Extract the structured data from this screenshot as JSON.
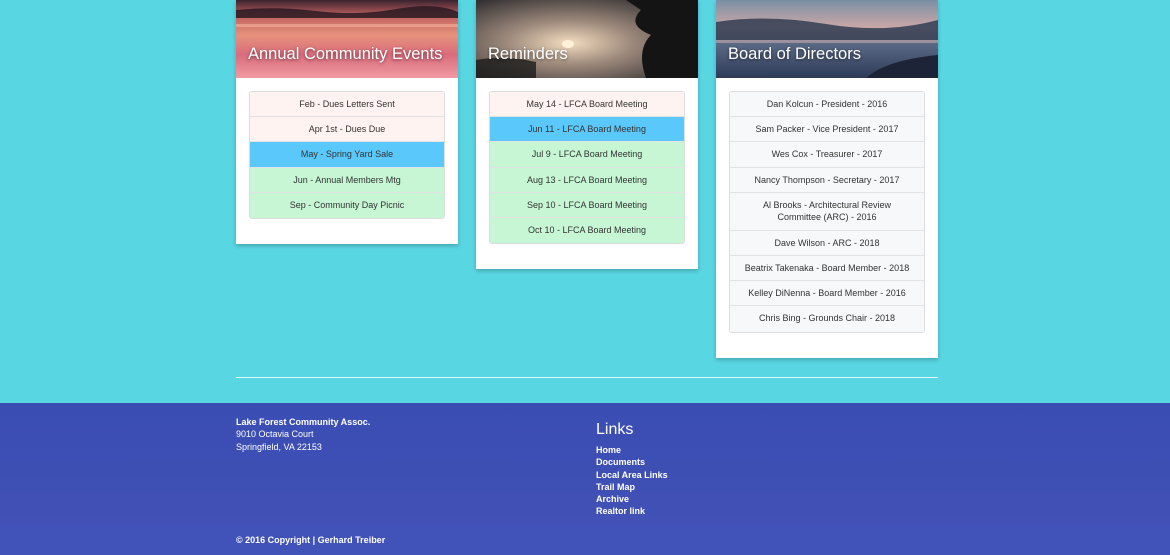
{
  "cards": [
    {
      "title": "Annual Community Events",
      "items": [
        {
          "label": "Feb - Dues Letters Sent",
          "style": "pink"
        },
        {
          "label": "Apr 1st - Dues Due",
          "style": "pink"
        },
        {
          "label": "May - Spring Yard Sale",
          "style": "blue"
        },
        {
          "label": "Jun - Annual Members Mtg",
          "style": "green"
        },
        {
          "label": "Sep - Community Day Picnic",
          "style": "green"
        }
      ]
    },
    {
      "title": "Reminders",
      "items": [
        {
          "label": "May 14 - LFCA Board Meeting",
          "style": "pink"
        },
        {
          "label": "Jun 11 - LFCA Board Meeting",
          "style": "blue"
        },
        {
          "label": "Jul 9 - LFCA Board Meeting",
          "style": "green"
        },
        {
          "label": "Aug 13 - LFCA Board Meeting",
          "style": "green"
        },
        {
          "label": "Sep 10 - LFCA Board Meeting",
          "style": "green"
        },
        {
          "label": "Oct 10 - LFCA Board Meeting",
          "style": "green"
        }
      ]
    },
    {
      "title": "Board of Directors",
      "items": [
        {
          "label": "Dan Kolcun - President - 2016",
          "style": "gray"
        },
        {
          "label": "Sam Packer - Vice President - 2017",
          "style": "gray"
        },
        {
          "label": "Wes Cox - Treasurer - 2017",
          "style": "gray"
        },
        {
          "label": "Nancy Thompson - Secretary - 2017",
          "style": "gray"
        },
        {
          "label": "Al Brooks - Architectural Review Committee (ARC) - 2016",
          "style": "gray"
        },
        {
          "label": "Dave Wilson - ARC - 2018",
          "style": "gray"
        },
        {
          "label": "Beatrix Takenaka - Board Member - 2018",
          "style": "gray"
        },
        {
          "label": "Kelley DiNenna - Board Member - 2016",
          "style": "gray"
        },
        {
          "label": "Chris Bing - Grounds Chair - 2018",
          "style": "gray"
        }
      ]
    }
  ],
  "footer": {
    "assoc_name": "Lake Forest Community Assoc.",
    "address_line1": "9010 Octavia Court",
    "address_line2": "Springfield, VA 22153",
    "links_title": "Links",
    "links": [
      "Home",
      "Documents",
      "Local Area Links",
      "Trail Map",
      "Archive",
      "Realtor link"
    ],
    "copyright": "© 2016 Copyright | Gerhard Treiber"
  },
  "colors": {
    "page_bg": "#58d6e2",
    "footer_bg": "#3f51b5",
    "highlight_blue": "#5ac8fa",
    "highlight_green": "#c6f6d3",
    "highlight_pink": "#fff3f1"
  }
}
